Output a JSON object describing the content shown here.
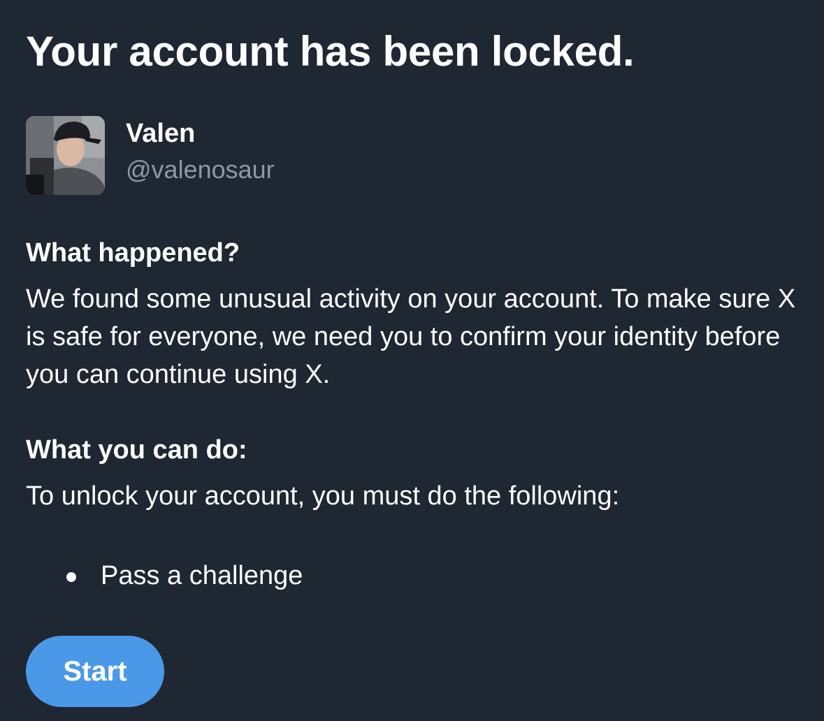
{
  "title": "Your account has been locked.",
  "user": {
    "name": "Valen",
    "handle": "@valenosaur",
    "avatar_icon": "profile-photo"
  },
  "what_happened": {
    "heading": "What happened?",
    "body": "We found some unusual activity on your account. To make sure X is safe for everyone, we need you to confirm your identity before you can continue using X."
  },
  "what_you_can_do": {
    "heading": "What you can do:",
    "body": "To unlock your account, you must do the following:",
    "steps": [
      {
        "label": "Pass a challenge"
      }
    ]
  },
  "actions": {
    "start_label": "Start"
  },
  "colors": {
    "background": "#1f2733",
    "text": "#ffffff",
    "secondary_text": "#8b98a5",
    "accent": "#4a99e9"
  }
}
